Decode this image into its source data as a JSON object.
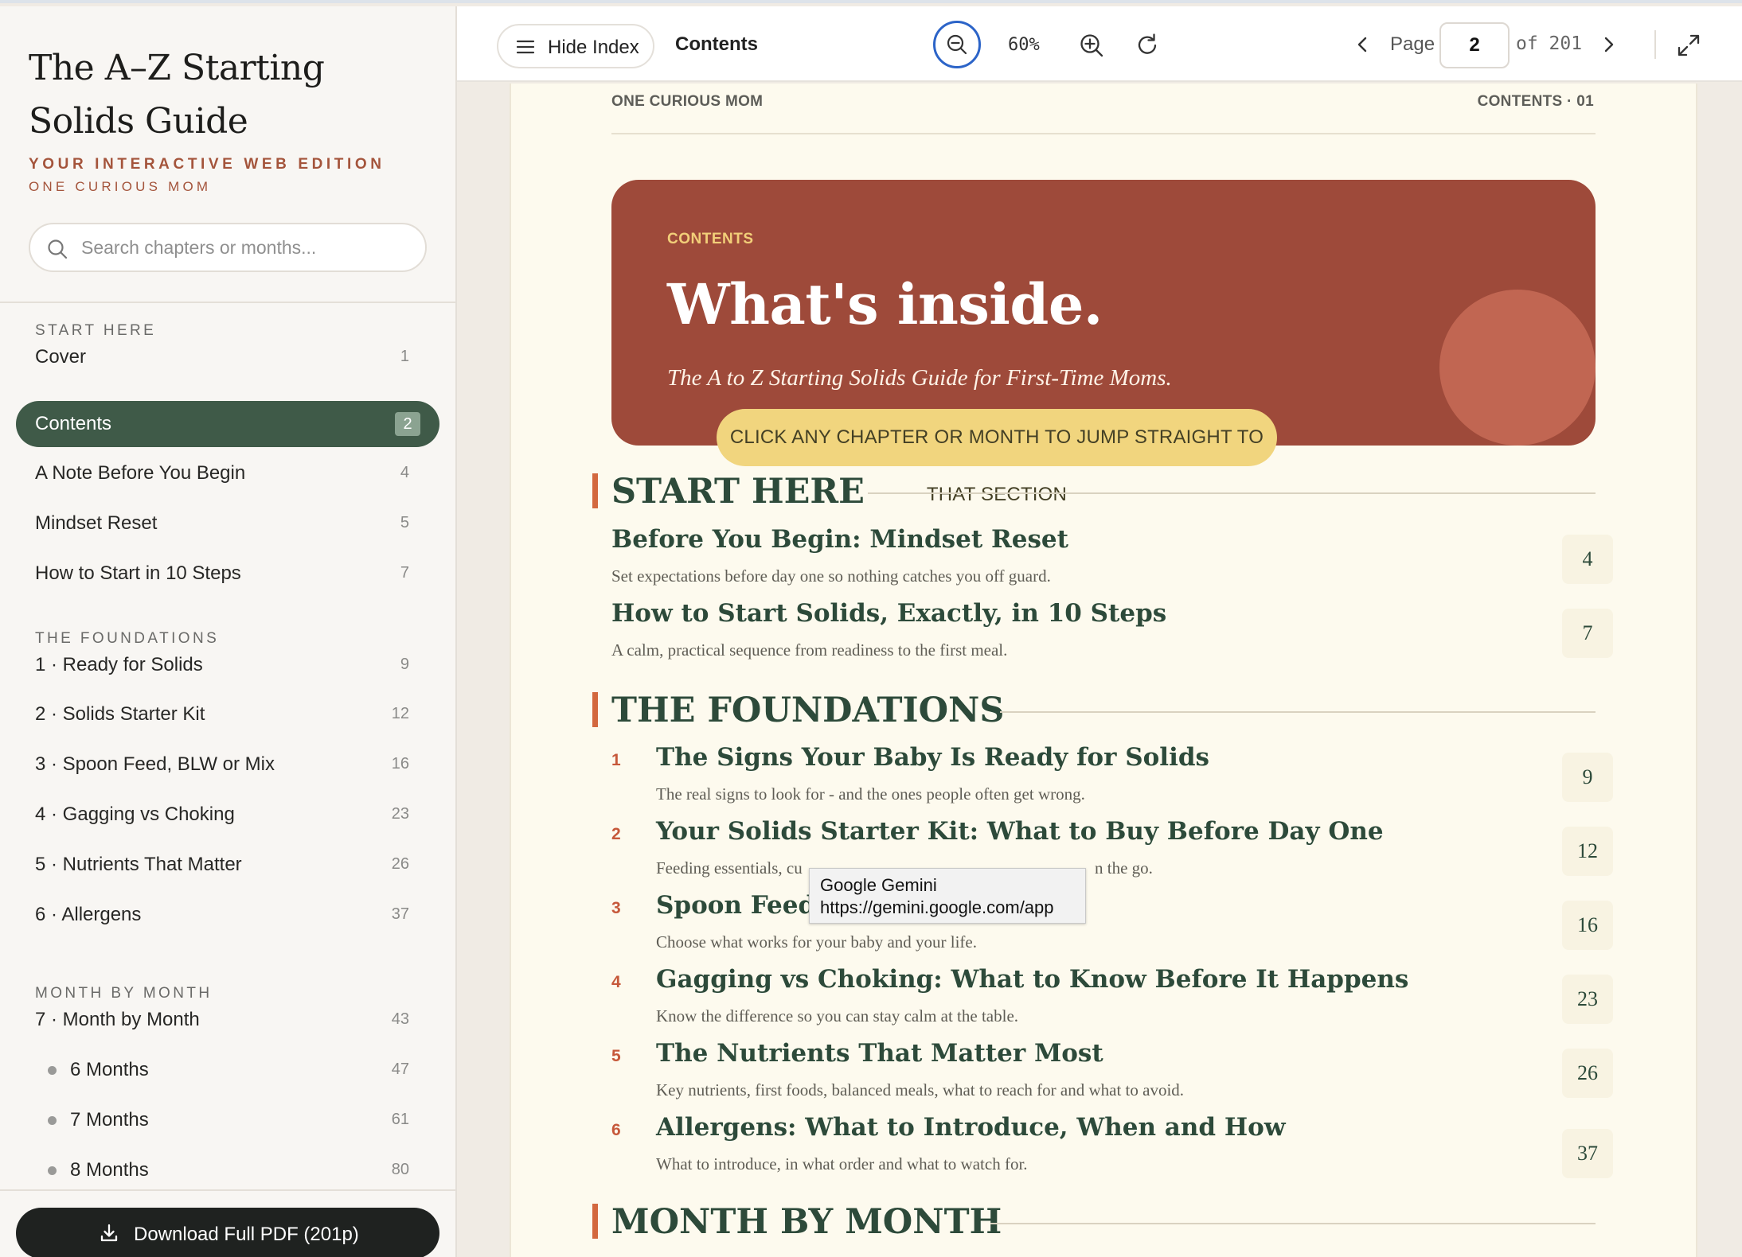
{
  "sidebar": {
    "title_line1": "The A–Z Starting",
    "title_line2": "Solids Guide",
    "subtitle": "YOUR INTERACTIVE WEB EDITION",
    "author": "ONE CURIOUS MOM",
    "search_placeholder": "Search chapters or months...",
    "sections": [
      {
        "label": "START HERE"
      },
      {
        "label": "THE FOUNDATIONS"
      },
      {
        "label": "MONTH BY MONTH"
      }
    ],
    "items": [
      {
        "label": "Cover",
        "page": "1"
      },
      {
        "label": "Contents",
        "page": "2",
        "active": true
      },
      {
        "label": "A Note Before You Begin",
        "page": "4"
      },
      {
        "label": "Mindset Reset",
        "page": "5"
      },
      {
        "label": "How to Start in 10 Steps",
        "page": "7"
      },
      {
        "label": "1 · Ready for Solids",
        "page": "9"
      },
      {
        "label": "2 · Solids Starter Kit",
        "page": "12"
      },
      {
        "label": "3 · Spoon Feed, BLW or Mix",
        "page": "16"
      },
      {
        "label": "4 · Gagging vs Choking",
        "page": "23"
      },
      {
        "label": "5 · Nutrients That Matter",
        "page": "26"
      },
      {
        "label": "6 · Allergens",
        "page": "37"
      },
      {
        "label": "7 · Month by Month",
        "page": "43"
      },
      {
        "label": "6 Months",
        "page": "47"
      },
      {
        "label": "7 Months",
        "page": "61"
      },
      {
        "label": "8 Months",
        "page": "80"
      }
    ],
    "download_label": "Download Full PDF (201p)"
  },
  "toolbar": {
    "hide_index_label": "Hide Index",
    "section_label": "Contents",
    "zoom": "60%",
    "page_label": "Page",
    "current_page": "2",
    "total_pages": "of 201"
  },
  "document": {
    "header_left": "ONE CURIOUS MOM",
    "header_right": "CONTENTS · 01",
    "hero": {
      "eyebrow": "CONTENTS",
      "title": "What's inside.",
      "subtitle": "The A to Z Starting Solids Guide for First-Time Moms.",
      "cta": "CLICK ANY CHAPTER OR MONTH TO JUMP STRAIGHT TO THAT SECTION"
    },
    "sections": [
      {
        "title": "START HERE",
        "entries": [
          {
            "num": "",
            "title": "Before You Begin: Mindset Reset",
            "desc": "Set expectations before day one so nothing catches you off guard.",
            "page": "4"
          },
          {
            "num": "",
            "title": "How to Start Solids, Exactly, in 10 Steps",
            "desc": "A calm, practical sequence from readiness to the first meal.",
            "page": "7"
          }
        ]
      },
      {
        "title": "THE FOUNDATIONS",
        "entries": [
          {
            "num": "1",
            "title": "The Signs Your Baby Is Ready for Solids",
            "desc": "The real signs to look for - and the ones people often get wrong.",
            "page": "9"
          },
          {
            "num": "2",
            "title": "Your Solids Starter Kit: What to Buy Before Day One",
            "desc": "Feeding essentials, cu",
            "desc_tail": "n the go.",
            "page": "12"
          },
          {
            "num": "3",
            "title": "Spoon Feed,",
            "desc": "Choose what works for your baby and your life.",
            "page": "16"
          },
          {
            "num": "4",
            "title": "Gagging vs Choking: What to Know Before It Happens",
            "desc": "Know the difference so you can stay calm at the table.",
            "page": "23"
          },
          {
            "num": "5",
            "title": "The Nutrients That Matter Most",
            "desc": "Key nutrients, first foods, balanced meals, what to reach for and what to avoid.",
            "page": "26"
          },
          {
            "num": "6",
            "title": "Allergens: What to Introduce, When and How",
            "desc": "What to introduce, in what order and what to watch for.",
            "page": "37"
          }
        ]
      },
      {
        "title": "MONTH BY MONTH",
        "entries": []
      }
    ]
  },
  "tooltip": {
    "line1": "Google Gemini",
    "line2": "https://gemini.google.com/app"
  },
  "colors": {
    "sidebar_active": "#3f5a48",
    "hero_bg": "#9e4a3a",
    "accent_yellow": "#f1d57e",
    "heading_green": "#2d4a3a",
    "accent_orange": "#d3683f",
    "zoom_focus_ring": "#2c64c8"
  },
  "icons": [
    "search-icon",
    "download-icon",
    "menu-icon",
    "zoom-out-icon",
    "zoom-in-icon",
    "rotate-icon",
    "chevron-left-icon",
    "chevron-right-icon",
    "fullscreen-icon"
  ]
}
